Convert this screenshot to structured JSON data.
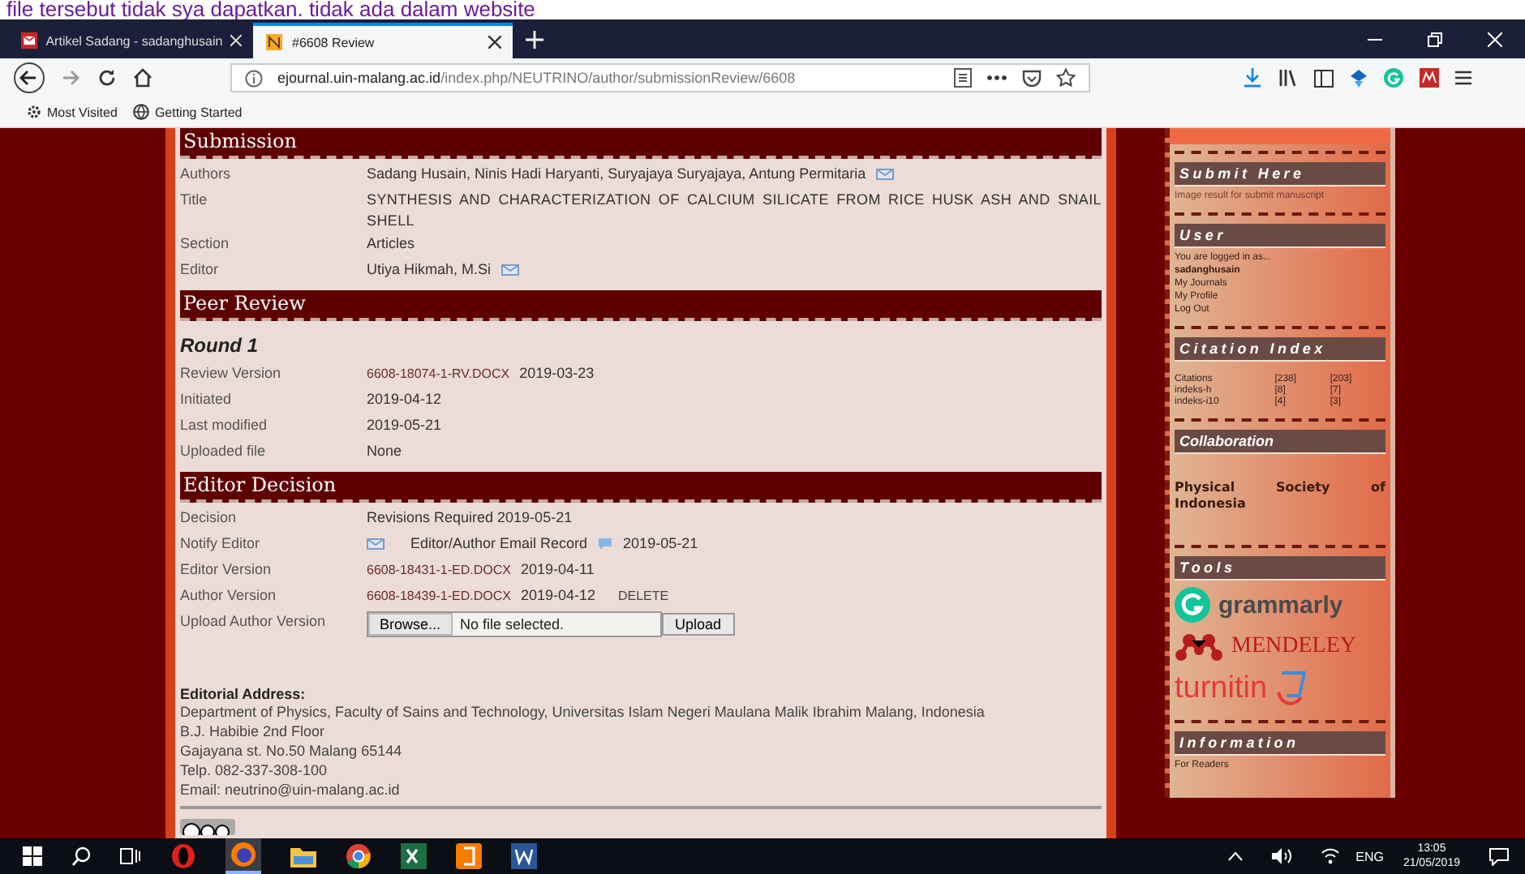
{
  "caption": "file tersebut tidak sya dapatkan. tidak ada dalam website",
  "browser": {
    "tabs": [
      {
        "title": "Artikel Sadang - sadanghusain",
        "selected": false
      },
      {
        "title": "#6608 Review",
        "selected": true
      }
    ],
    "url_host": "ejournal.uin-malang.ac.id",
    "url_path": "/index.php/NEUTRINO/author/submissionReview/6608",
    "bookmarks": [
      "Most Visited",
      "Getting Started"
    ]
  },
  "sections": [
    {
      "heading": "Submission",
      "rows": [
        {
          "kind": "mail",
          "label": "Authors",
          "value": "Sadang Husain, Ninis Hadi Haryanti, Suryajaya Suryajaya, Antung Permitaria"
        },
        {
          "kind": "text",
          "label": "Title",
          "value": "SYNTHESIS AND CHARACTERIZATION OF CALCIUM SILICATE FROM RICE HUSK ASH AND SNAIL SHELL"
        },
        {
          "kind": "text",
          "label": "Section",
          "value": "Articles"
        },
        {
          "kind": "mail",
          "label": "Editor",
          "value": "Utiya Hikmah, M.Si"
        }
      ]
    },
    {
      "heading": "Peer Review",
      "round": "Round 1",
      "rows": [
        {
          "kind": "file",
          "label": "Review Version",
          "file": "6608-18074-1-RV.DOCX",
          "date": "2019-03-23"
        },
        {
          "kind": "text",
          "label": "Initiated",
          "value": "2019-04-12"
        },
        {
          "kind": "text",
          "label": "Last modified",
          "value": "2019-05-21"
        },
        {
          "kind": "text",
          "label": "Uploaded file",
          "value": "None"
        }
      ]
    },
    {
      "heading": "Editor Decision",
      "rows": [
        {
          "kind": "text",
          "label": "Decision",
          "value": "Revisions Required 2019-05-21"
        },
        {
          "kind": "notify",
          "label": "Notify Editor",
          "link": "Editor/Author Email Record",
          "date": "2019-05-21"
        },
        {
          "kind": "file",
          "label": "Editor Version",
          "file": "6608-18431-1-ED.DOCX",
          "date": "2019-04-11"
        },
        {
          "kind": "file",
          "label": "Author Version",
          "file": "6608-18439-1-ED.DOCX",
          "date": "2019-04-12",
          "action": "DELETE"
        },
        {
          "kind": "upload",
          "label": "Upload Author Version",
          "browse": "Browse...",
          "status": "No file selected.",
          "button": "Upload"
        }
      ]
    }
  ],
  "address": {
    "heading": "Editorial Address:",
    "lines": [
      "Department of Physics, Faculty of Sains and Technology, Universitas Islam Negeri Maulana Malik Ibrahim Malang, Indonesia",
      "B.J. Habibie 2nd Floor",
      "Gajayana st. No.50 Malang 65144",
      "Telp. 082-337-308-100",
      "Email: neutrino@uin-malang.ac.id"
    ]
  },
  "sidebar": [
    {
      "kind": "caption",
      "title": "Submit Here",
      "text": "Image result for submit manuscript"
    },
    {
      "kind": "user",
      "title": "User",
      "intro": "You are logged in as...",
      "username": "sadanghusain",
      "links": [
        "My Journals",
        "My Profile",
        "Log Out"
      ]
    },
    {
      "kind": "citations",
      "title": "Citation Index",
      "rows": [
        [
          "Citations",
          "[238]",
          "[203]"
        ],
        [
          "indeks-h",
          "[8]",
          "[7]"
        ],
        [
          "indeks-i10",
          "[4]",
          "[3]"
        ]
      ]
    },
    {
      "kind": "collab",
      "title": "Collaboration",
      "text": "Physical Society of Indonesia"
    },
    {
      "kind": "tools",
      "title": "Tools",
      "logos": [
        {
          "kind": "grammarly",
          "text": "grammarly"
        },
        {
          "kind": "mendeley",
          "text": "MENDELEY"
        },
        {
          "kind": "turnitin",
          "text": "turnitin"
        }
      ]
    },
    {
      "kind": "info",
      "title": "Information",
      "links": [
        "For Readers"
      ]
    }
  ],
  "taskbar": {
    "lang": "ENG",
    "time": "13:05",
    "date": "21/05/2019"
  }
}
